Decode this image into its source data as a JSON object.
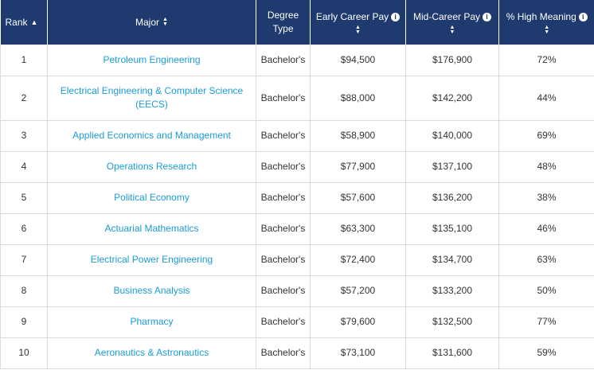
{
  "headers": {
    "rank": "Rank",
    "major": "Major",
    "degree_line1": "Degree",
    "degree_line2": "Type",
    "early": "Early Career Pay",
    "mid": "Mid-Career Pay",
    "meaning": "% High Meaning"
  },
  "icons": {
    "sort_asc": "sort-ascending-icon",
    "sort_both": "sort-both-icon",
    "info": "info-icon"
  },
  "glyphs": {
    "asc": "▲",
    "both": "▲▼",
    "info": "i"
  },
  "colors": {
    "header_bg": "#1e3a6e",
    "link": "#1a9cd8",
    "border": "#dcdcdc"
  },
  "rows": [
    {
      "rank": "1",
      "major": "Petroleum Engineering",
      "degree": "Bachelor's",
      "early": "$94,500",
      "mid": "$176,900",
      "meaning": "72%"
    },
    {
      "rank": "2",
      "major_line1": "Electrical Engineering & Computer Science",
      "major_line2": "(EECS)",
      "degree": "Bachelor's",
      "early": "$88,000",
      "mid": "$142,200",
      "meaning": "44%"
    },
    {
      "rank": "3",
      "major": "Applied Economics and Management",
      "degree": "Bachelor's",
      "early": "$58,900",
      "mid": "$140,000",
      "meaning": "69%"
    },
    {
      "rank": "4",
      "major": "Operations Research",
      "degree": "Bachelor's",
      "early": "$77,900",
      "mid": "$137,100",
      "meaning": "48%"
    },
    {
      "rank": "5",
      "major": "Political Economy",
      "degree": "Bachelor's",
      "early": "$57,600",
      "mid": "$136,200",
      "meaning": "38%"
    },
    {
      "rank": "6",
      "major": "Actuarial Mathematics",
      "degree": "Bachelor's",
      "early": "$63,300",
      "mid": "$135,100",
      "meaning": "46%"
    },
    {
      "rank": "7",
      "major": "Electrical Power Engineering",
      "degree": "Bachelor's",
      "early": "$72,400",
      "mid": "$134,700",
      "meaning": "63%"
    },
    {
      "rank": "8",
      "major": "Business Analysis",
      "degree": "Bachelor's",
      "early": "$57,200",
      "mid": "$133,200",
      "meaning": "50%"
    },
    {
      "rank": "9",
      "major": "Pharmacy",
      "degree": "Bachelor's",
      "early": "$79,600",
      "mid": "$132,500",
      "meaning": "77%"
    },
    {
      "rank": "10",
      "major": "Aeronautics & Astronautics",
      "degree": "Bachelor's",
      "early": "$73,100",
      "mid": "$131,600",
      "meaning": "59%"
    }
  ]
}
